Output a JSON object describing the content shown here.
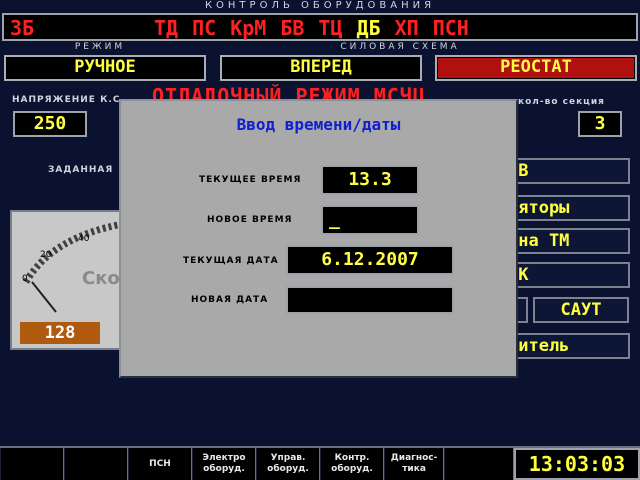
{
  "header": {
    "title": "КОНТРОЛЬ ОБОРУДОВАНИЯ",
    "status_code": "ЗБ",
    "indicators": [
      "ТД",
      "ПС",
      "КрМ",
      "БВ",
      "ТЦ",
      "ДБ",
      "ХП",
      "ПСН"
    ]
  },
  "mode": {
    "caption": "РЕЖИМ",
    "value": "РУЧНОЕ"
  },
  "power_scheme": {
    "caption": "СИЛОВАЯ СХЕМА",
    "direction": "ВПЕРЕД",
    "state": "РЕОСТАТ"
  },
  "status_line": "ОТЛАДОЧНЫЙ РЕЖИМ МСЧЦ",
  "voltage": {
    "label": "НАПРЯЖЕНИЕ К.С",
    "value": "250"
  },
  "sections": {
    "label": "кол-во секция",
    "value": "3"
  },
  "set_label": "ЗАДАННАЯ",
  "gauge": {
    "ticks": [
      "0",
      "20",
      "40"
    ],
    "title": "Ско",
    "readout": "128"
  },
  "side_buttons": [
    "БВ",
    "ляторы",
    "ена ТМ",
    "ПК",
    "",
    "САУТ",
    "дитель"
  ],
  "dialog": {
    "title": "Ввод времени/даты",
    "current_time_label": "ТЕКУЩЕЕ ВРЕМЯ",
    "current_time": "13.3",
    "new_time_label": "НОВОЕ ВРЕМЯ",
    "new_time": "_",
    "current_date_label": "ТЕКУЩАЯ ДАТА",
    "current_date": "6.12.2007",
    "new_date_label": "НОВАЯ ДАТА",
    "new_date": ""
  },
  "bottom_bar": {
    "items": [
      "",
      "",
      "ПСН",
      "Электро оборуд.",
      "Управ. оборуд.",
      "Контр. оборуд.",
      "Диагнос- тика"
    ],
    "clock": "13:03:03"
  }
}
